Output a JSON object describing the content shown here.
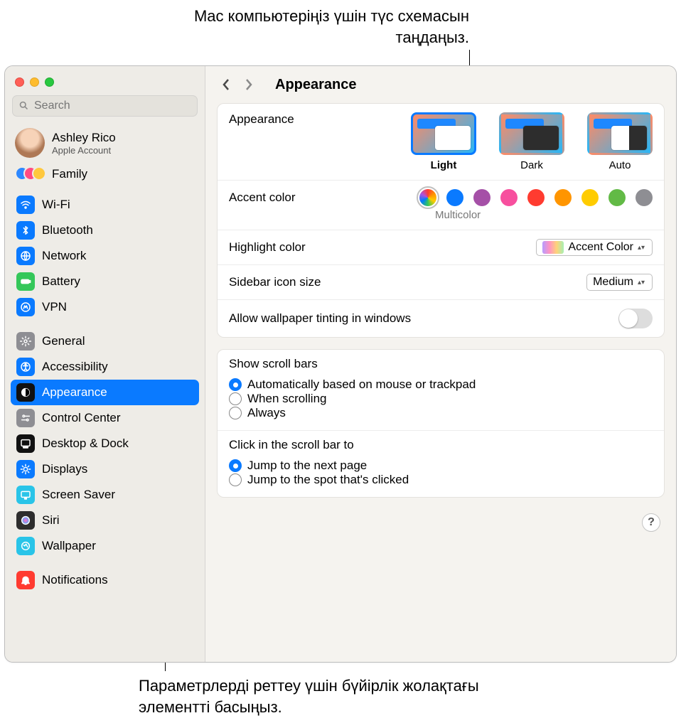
{
  "callouts": {
    "top": "Mac компьютеріңіз үшін түс схемасын таңдаңыз.",
    "bottom": "Параметрлерді реттеу үшін бүйірлік жолақтағы элементті басыңыз."
  },
  "search_placeholder": "Search",
  "account": {
    "name": "Ashley Rico",
    "sub": "Apple Account"
  },
  "family_label": "Family",
  "sidebar_groups": [
    [
      {
        "id": "wifi",
        "label": "Wi-Fi",
        "bg": "#0a7aff",
        "glyph": "wifi"
      },
      {
        "id": "bluetooth",
        "label": "Bluetooth",
        "bg": "#0a7aff",
        "glyph": "bt"
      },
      {
        "id": "network",
        "label": "Network",
        "bg": "#0a7aff",
        "glyph": "globe"
      },
      {
        "id": "battery",
        "label": "Battery",
        "bg": "#34c759",
        "glyph": "battery"
      },
      {
        "id": "vpn",
        "label": "VPN",
        "bg": "#0a7aff",
        "glyph": "vpn"
      }
    ],
    [
      {
        "id": "general",
        "label": "General",
        "bg": "#8e8e93",
        "glyph": "gear"
      },
      {
        "id": "accessibility",
        "label": "Accessibility",
        "bg": "#0a7aff",
        "glyph": "acc"
      },
      {
        "id": "appearance",
        "label": "Appearance",
        "bg": "#111",
        "glyph": "appear",
        "selected": true
      },
      {
        "id": "control-center",
        "label": "Control Center",
        "bg": "#8e8e93",
        "glyph": "cc"
      },
      {
        "id": "desktop-dock",
        "label": "Desktop & Dock",
        "bg": "#111",
        "glyph": "dock"
      },
      {
        "id": "displays",
        "label": "Displays",
        "bg": "#0a7aff",
        "glyph": "display"
      },
      {
        "id": "screen-saver",
        "label": "Screen Saver",
        "bg": "#29c4e8",
        "glyph": "ss"
      },
      {
        "id": "siri",
        "label": "Siri",
        "bg": "#2d2d2d",
        "glyph": "siri"
      },
      {
        "id": "wallpaper",
        "label": "Wallpaper",
        "bg": "#29c4e8",
        "glyph": "wall"
      },
      {
        "id": "spacer",
        "spacer": true
      },
      {
        "id": "notifications",
        "label": "Notifications",
        "bg": "#ff3b30",
        "glyph": "bell"
      }
    ]
  ],
  "page_title": "Appearance",
  "labels": {
    "appearance": "Appearance",
    "accent": "Accent color",
    "accent_selected_name": "Multicolor",
    "highlight": "Highlight color",
    "highlight_value": "Accent Color",
    "sidebar_icon": "Sidebar icon size",
    "sidebar_icon_value": "Medium",
    "tint": "Allow wallpaper tinting in windows",
    "scrollbars_title": "Show scroll bars",
    "scrollbars_options": [
      "Automatically based on mouse or trackpad",
      "When scrolling",
      "Always"
    ],
    "scrollbars_selected": 0,
    "click_title": "Click in the scroll bar to",
    "click_options": [
      "Jump to the next page",
      "Jump to the spot that's clicked"
    ],
    "click_selected": 0
  },
  "appearance_options": [
    {
      "name": "Light",
      "selected": true,
      "kind": "light"
    },
    {
      "name": "Dark",
      "selected": false,
      "kind": "dark"
    },
    {
      "name": "Auto",
      "selected": false,
      "kind": "auto"
    }
  ],
  "accent_colors": [
    {
      "name": "Multicolor",
      "css": "multi",
      "selected": true
    },
    {
      "name": "Blue",
      "css": "#0a7aff"
    },
    {
      "name": "Purple",
      "css": "#a550a7"
    },
    {
      "name": "Pink",
      "css": "#f74f9e"
    },
    {
      "name": "Red",
      "css": "#ff3b30"
    },
    {
      "name": "Orange",
      "css": "#ff9500"
    },
    {
      "name": "Yellow",
      "css": "#ffcc00"
    },
    {
      "name": "Green",
      "css": "#62ba46"
    },
    {
      "name": "Graphite",
      "css": "#8e8e93"
    }
  ],
  "tint_enabled": false,
  "help_label": "?"
}
